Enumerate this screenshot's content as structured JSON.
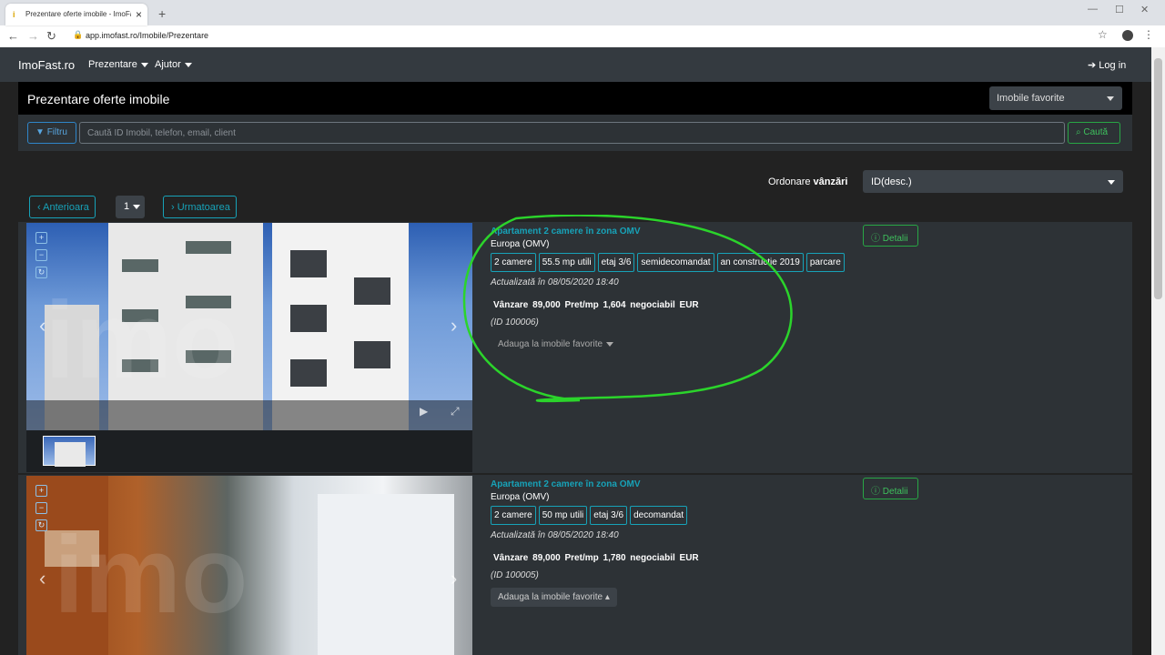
{
  "browser": {
    "tab_title": "Prezentare oferte imobile - ImoFast.ro",
    "url": "app.imofast.ro/Imobile/Prezentare",
    "new_tab": "+",
    "close_tab": "×"
  },
  "navbar": {
    "brand": "ImoFast.ro",
    "menu_prezentare": "Prezentare",
    "menu_ajutor": "Ajutor",
    "login": "Log in"
  },
  "header": {
    "title": "Prezentare oferte imobile",
    "favorites_dropdown": "Imobile favorite"
  },
  "search": {
    "filter_label": "Filtru",
    "placeholder": "Caută ID Imobil, telefon, email, client",
    "search_label": "Caută"
  },
  "sort": {
    "label": "Ordonare",
    "label_bold": "vânzări",
    "value": "ID(desc.)"
  },
  "pagination": {
    "prev": "Anterioara",
    "page": "1",
    "next": "Urmatoarea"
  },
  "listings": [
    {
      "title": "Apartament 2 camere în zona OMV",
      "location": "Europa (OMV)",
      "tags": [
        "2 camere",
        "55.5 mp utili",
        "etaj 3/6",
        "semidecomandat",
        "an constructie 2019",
        "parcare"
      ],
      "updated": "Actualizată în 08/05/2020 18:40",
      "price": "Vânzare 89,000 Pret/mp 1,604 negociabil EUR",
      "id": "(ID 100006)",
      "favorite": "Adauga la imobile favorite",
      "details": "Detalii"
    },
    {
      "title": "Apartament 2 camere în zona OMV",
      "location": "Europa (OMV)",
      "tags": [
        "2 camere",
        "50 mp utili",
        "etaj 3/6",
        "decomandat"
      ],
      "updated": "Actualizată în 08/05/2020 18:40",
      "price": "Vânzare 89,000 Pret/mp 1,780 negociabil EUR",
      "id": "(ID 100005)",
      "favorite": "Adauga la imobile favorite",
      "details": "Detalii"
    }
  ],
  "watermark": "imo"
}
